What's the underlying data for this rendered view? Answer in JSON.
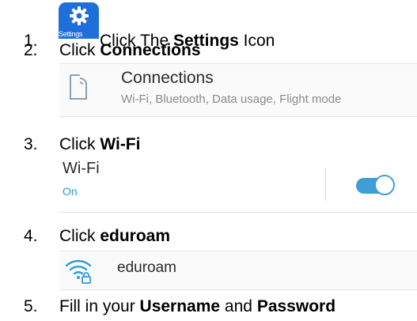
{
  "steps": [
    {
      "num": "1.",
      "pre": "Click The ",
      "bold": "Settings",
      "post": " Icon"
    },
    {
      "num": "2.",
      "pre": "Click ",
      "bold": "Connections",
      "post": ""
    },
    {
      "num": "3.",
      "pre": "Click ",
      "bold": "Wi-Fi",
      "post": ""
    },
    {
      "num": "4.",
      "pre": "Click ",
      "bold": "eduroam",
      "post": ""
    },
    {
      "num": "5.",
      "pre": "Fill in your ",
      "bold": "Username",
      "mid": " and ",
      "bold2": "Password"
    }
  ],
  "settings_icon": {
    "label": "Settings",
    "icon": "gear-icon",
    "color": "#1e6fd9"
  },
  "connections_panel": {
    "title": "Connections",
    "subtitle": "Wi-Fi, Bluetooth, Data usage, Flight mode",
    "icon": "phone-signal-icon"
  },
  "wifi_panel": {
    "title": "Wi-Fi",
    "state": "On",
    "toggle_on": true,
    "accent": "#3e9fd8"
  },
  "eduroam_panel": {
    "network": "eduroam",
    "icon": "wifi-lock-icon",
    "accent": "#2c9cd6"
  }
}
